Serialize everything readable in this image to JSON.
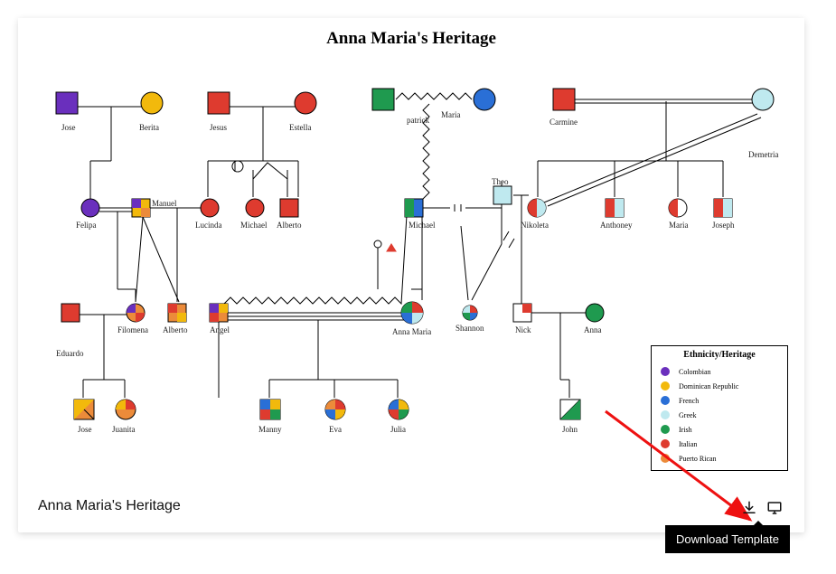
{
  "title": "Anna Maria's Heritage",
  "caption": "Anna Maria's Heritage",
  "tooltip": "Download Template",
  "legend": {
    "title": "Ethnicity/Heritage",
    "items": [
      {
        "label": "Colombian",
        "color": "#6a2fbd"
      },
      {
        "label": "Dominican Republic",
        "color": "#f2b90c"
      },
      {
        "label": "French",
        "color": "#2a6fd6"
      },
      {
        "label": "Greek",
        "color": "#bfe9ef"
      },
      {
        "label": "Irish",
        "color": "#1f9a4f"
      },
      {
        "label": "Italian",
        "color": "#de3b2f"
      },
      {
        "label": "Puerto Rican",
        "color": "#ec8b3a"
      }
    ]
  },
  "colors": {
    "colombian": "#6a2fbd",
    "dominican": "#f2b90c",
    "french": "#2a6fd6",
    "greek": "#bfe9ef",
    "irish": "#1f9a4f",
    "italian": "#de3b2f",
    "puertorican": "#ec8b3a",
    "white": "#ffffff"
  },
  "people_gen1": {
    "jose": "Jose",
    "berita": "Berita",
    "jesus": "Jesus",
    "estella": "Estella",
    "patrick": "patrick",
    "maria": "Maria",
    "carmine": "Carmine",
    "demetria": "Demetria"
  },
  "people_gen2": {
    "felipa": "Felipa",
    "manuel": "Manuel",
    "lucinda": "Lucinda",
    "michael_a": "Michael",
    "alberto_a": "Alberto",
    "michael_b": "Michael",
    "theo": "Theo",
    "nikoleta": "Nikoleta",
    "anthoney": "Anthoney",
    "maria2": "Maria",
    "joseph": "Joseph"
  },
  "people_gen3": {
    "eduardo": "Eduardo",
    "filomena": "Filomena",
    "alberto_b": "Alberto",
    "angel": "Angel",
    "anna_maria": "Anna Maria",
    "shannon": "Shannon",
    "nick": "Nick",
    "anna": "Anna"
  },
  "people_gen4": {
    "jose2": "Jose",
    "juanita": "Juanita",
    "manny": "Manny",
    "eva": "Eva",
    "julia": "Julia",
    "john": "John"
  }
}
